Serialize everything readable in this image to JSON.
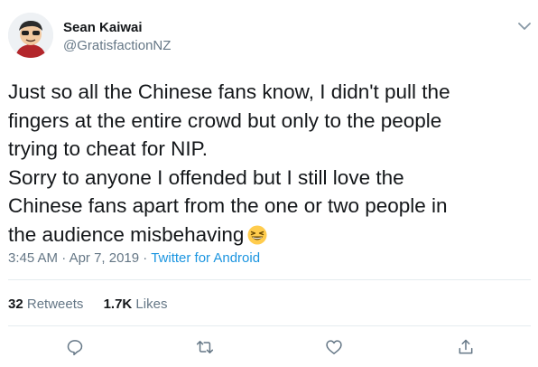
{
  "author": {
    "display_name": "Sean Kaiwai",
    "handle": "@GratisfactionNZ",
    "avatar_icon": "cartoon-avatar-icon"
  },
  "tweet": {
    "lines": [
      "Just so all the Chinese fans know, I didn't pull the",
      "fingers at the entire crowd but only to the people",
      "trying to cheat for NIP.",
      "Sorry to anyone I offended but I still love the",
      "Chinese fans apart from the one or two people in",
      "the audience misbehaving"
    ],
    "emoji": "grinning-squinting-face-icon"
  },
  "meta": {
    "time": "3:45 AM",
    "separator1": " · ",
    "date": "Apr 7, 2019",
    "separator2": " · ",
    "source": "Twitter for Android"
  },
  "stats": {
    "retweets_count": "32",
    "retweets_label": "Retweets",
    "likes_count": "1.7K",
    "likes_label": "Likes"
  },
  "actions": [
    "reply-icon",
    "retweet-icon",
    "like-icon",
    "share-icon"
  ],
  "colors": {
    "text": "#14171a",
    "secondary": "#657786",
    "link": "#1b95e0",
    "divider": "#e6ecf0"
  }
}
